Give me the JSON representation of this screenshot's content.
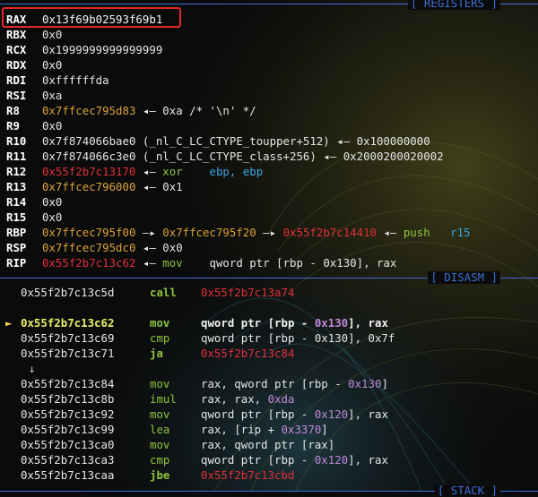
{
  "panels": {
    "registers_title": "[ REGISTERS ]",
    "disasm_title": "[ DISASM ]",
    "stack_title": "[ STACK ]"
  },
  "colors": {
    "highlight_box": "#e22626",
    "separator": "#3b6fd6",
    "pointer_red": "#e0313a",
    "pointer_yellow": "#d9a33a",
    "instruction_green": "#8fc43f",
    "register_blue": "#38a6e6",
    "offset_purple": "#c08ad9"
  },
  "registers": [
    {
      "name": "RAX",
      "parts": [
        {
          "t": "0x13f69b02593f69b1",
          "c": "w2"
        }
      ]
    },
    {
      "name": "RBX",
      "parts": [
        {
          "t": "0x0",
          "c": "w"
        }
      ]
    },
    {
      "name": "RCX",
      "parts": [
        {
          "t": "0x1999999999999999",
          "c": "w"
        }
      ]
    },
    {
      "name": "RDX",
      "parts": [
        {
          "t": "0x0",
          "c": "w"
        }
      ]
    },
    {
      "name": "RDI",
      "parts": [
        {
          "t": "0xffffffda",
          "c": "w"
        }
      ]
    },
    {
      "name": "RSI",
      "parts": [
        {
          "t": "0xa",
          "c": "w"
        }
      ]
    },
    {
      "name": "R8",
      "parts": [
        {
          "t": "0x7ffcec795d83",
          "c": "y"
        },
        {
          "t": " ◂— 0xa /* '\\n' */",
          "c": "w"
        }
      ]
    },
    {
      "name": "R9",
      "parts": [
        {
          "t": "0x0",
          "c": "w"
        }
      ]
    },
    {
      "name": "R10",
      "parts": [
        {
          "t": "0x7f874066bae0 (_nl_C_LC_CTYPE_toupper+512) ◂— 0x100000000",
          "c": "w"
        }
      ]
    },
    {
      "name": "R11",
      "parts": [
        {
          "t": "0x7f874066c3e0 (_nl_C_LC_CTYPE_class+256) ◂— 0x2000200020002",
          "c": "w"
        }
      ]
    },
    {
      "name": "R12",
      "parts": [
        {
          "t": "0x55f2b7c13170",
          "c": "r"
        },
        {
          "t": " ◂— ",
          "c": "w"
        },
        {
          "t": "xor",
          "c": "g"
        },
        {
          "t": "    ",
          "c": "w"
        },
        {
          "t": "ebp, ebp",
          "c": "b"
        }
      ]
    },
    {
      "name": "R13",
      "parts": [
        {
          "t": "0x7ffcec796000",
          "c": "y"
        },
        {
          "t": " ◂— 0x1",
          "c": "w"
        }
      ]
    },
    {
      "name": "R14",
      "parts": [
        {
          "t": "0x0",
          "c": "w"
        }
      ]
    },
    {
      "name": "R15",
      "parts": [
        {
          "t": "0x0",
          "c": "w"
        }
      ]
    },
    {
      "name": "RBP",
      "parts": [
        {
          "t": "0x7ffcec795f00",
          "c": "y"
        },
        {
          "t": " —▸ ",
          "c": "w"
        },
        {
          "t": "0x7ffcec795f20",
          "c": "y"
        },
        {
          "t": " —▸ ",
          "c": "w"
        },
        {
          "t": "0x55f2b7c14410",
          "c": "r"
        },
        {
          "t": " ◂— ",
          "c": "w"
        },
        {
          "t": "push",
          "c": "g"
        },
        {
          "t": "   ",
          "c": "w"
        },
        {
          "t": "r15",
          "c": "b"
        }
      ]
    },
    {
      "name": "RSP",
      "parts": [
        {
          "t": "0x7ffcec795dc0",
          "c": "y"
        },
        {
          "t": " ◂— 0x0",
          "c": "w"
        }
      ]
    },
    {
      "name": "RIP",
      "parts": [
        {
          "t": "0x55f2b7c13c62",
          "c": "r"
        },
        {
          "t": " ◂— ",
          "c": "w"
        },
        {
          "t": "mov",
          "c": "g"
        },
        {
          "t": "    qword ptr [rbp - 0x130], rax",
          "c": "w"
        }
      ]
    }
  ],
  "disasm": [
    {
      "type": "ins",
      "addr": "0x55f2b7c13c5d",
      "mn": "call",
      "mn_bold": true,
      "ops": [
        {
          "t": "0x55f2b7c13a74",
          "c": "r"
        }
      ]
    },
    {
      "type": "blank"
    },
    {
      "type": "ins",
      "current": true,
      "marker": "►",
      "addr": "0x55f2b7c13c62",
      "mn": "mov",
      "mn_bold": true,
      "ops": [
        {
          "t": "qword ptr [rbp - ",
          "c": "w2"
        },
        {
          "t": "0x130",
          "c": "p"
        },
        {
          "t": "], rax",
          "c": "w2"
        }
      ]
    },
    {
      "type": "ins",
      "addr": "0x55f2b7c13c69",
      "mn": "cmp",
      "ops": [
        {
          "t": "qword ptr [rbp - 0x130], 0x7f",
          "c": "w"
        }
      ]
    },
    {
      "type": "ins",
      "addr": "0x55f2b7c13c71",
      "mn": "ja",
      "mn_bold": true,
      "ops": [
        {
          "t": "0x55f2b7c13c84",
          "c": "r"
        }
      ]
    },
    {
      "type": "arrow",
      "t": "↓"
    },
    {
      "type": "ins",
      "addr": "0x55f2b7c13c84",
      "mn": "mov",
      "ops": [
        {
          "t": "rax, qword ptr [rbp - ",
          "c": "w"
        },
        {
          "t": "0x130",
          "c": "p"
        },
        {
          "t": "]",
          "c": "w"
        }
      ]
    },
    {
      "type": "ins",
      "addr": "0x55f2b7c13c8b",
      "mn": "imul",
      "ops": [
        {
          "t": "rax, rax, ",
          "c": "w"
        },
        {
          "t": "0xda",
          "c": "p"
        }
      ]
    },
    {
      "type": "ins",
      "addr": "0x55f2b7c13c92",
      "mn": "mov",
      "ops": [
        {
          "t": "qword ptr [rbp - ",
          "c": "w"
        },
        {
          "t": "0x120",
          "c": "p"
        },
        {
          "t": "], rax",
          "c": "w"
        }
      ]
    },
    {
      "type": "ins",
      "addr": "0x55f2b7c13c99",
      "mn": "lea",
      "ops": [
        {
          "t": "rax, [rip + ",
          "c": "w"
        },
        {
          "t": "0x3370",
          "c": "p"
        },
        {
          "t": "]",
          "c": "w"
        }
      ]
    },
    {
      "type": "ins",
      "addr": "0x55f2b7c13ca0",
      "mn": "mov",
      "ops": [
        {
          "t": "rax, qword ptr [rax]",
          "c": "w"
        }
      ]
    },
    {
      "type": "ins",
      "addr": "0x55f2b7c13ca3",
      "mn": "cmp",
      "ops": [
        {
          "t": "qword ptr [rbp - ",
          "c": "w"
        },
        {
          "t": "0x120",
          "c": "p"
        },
        {
          "t": "], rax",
          "c": "w"
        }
      ]
    },
    {
      "type": "ins",
      "addr": "0x55f2b7c13caa",
      "mn": "jbe",
      "mn_bold": true,
      "ops": [
        {
          "t": "0x55f2b7c13cbd",
          "c": "r"
        }
      ]
    }
  ]
}
